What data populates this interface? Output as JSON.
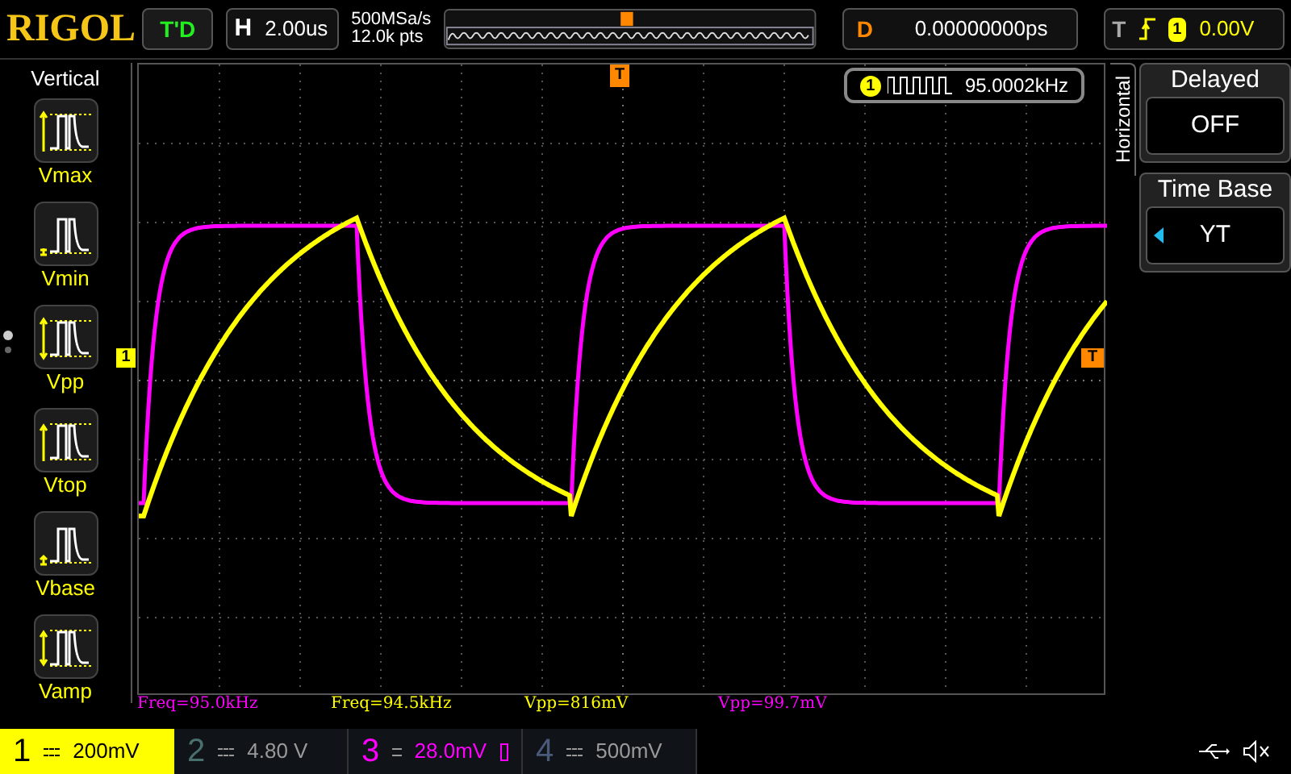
{
  "header": {
    "logo": "RIGOL",
    "run_status": "T'D",
    "horizontal_label": "H",
    "timebase": "2.00us",
    "sample_rate": "500MSa/s",
    "memory_depth": "12.0k pts",
    "delay_label": "D",
    "delay": "0.00000000ps",
    "trigger_label": "T",
    "trigger_channel": "1",
    "trigger_level": "0.00V"
  },
  "left_menu": {
    "title": "Vertical",
    "items": [
      {
        "label": "Vmax",
        "kind": "max"
      },
      {
        "label": "Vmin",
        "kind": "min"
      },
      {
        "label": "Vpp",
        "kind": "pp"
      },
      {
        "label": "Vtop",
        "kind": "top"
      },
      {
        "label": "Vbase",
        "kind": "base"
      },
      {
        "label": "Vamp",
        "kind": "amp"
      }
    ],
    "pages": [
      {
        "selected": true
      },
      {
        "selected": false
      }
    ]
  },
  "screen": {
    "channel_marker": "1",
    "trigger_marker_top": "T",
    "trigger_marker_right": "T",
    "counter": {
      "channel": "1",
      "frequency": "95.0002kHz"
    }
  },
  "right_menu": {
    "title": "Horizontal",
    "items": [
      {
        "label": "Delayed",
        "value": "OFF",
        "arrow": false
      },
      {
        "label": "Time Base",
        "value": "YT",
        "arrow": true
      }
    ]
  },
  "measurements": [
    {
      "text": "Freq=95.0kHz",
      "color": "#ff00ff"
    },
    {
      "text": "Freq=94.5kHz",
      "color": "#ffff00"
    },
    {
      "text": "Vpp=816mV",
      "color": "#ffff00"
    },
    {
      "text": "Vpp=99.7mV",
      "color": "#ff00ff"
    }
  ],
  "channels": [
    {
      "number": "1",
      "scale": "200mV",
      "color": "#ffff00",
      "selected": true,
      "badge": false
    },
    {
      "number": "2",
      "scale": "4.80 V",
      "color": "#4a6f6f",
      "selected": false,
      "badge": false
    },
    {
      "number": "3",
      "scale": "28.0mV",
      "color": "#ff00ff",
      "selected": false,
      "badge": true
    },
    {
      "number": "4",
      "scale": "500mV",
      "color": "#4a5a7a",
      "selected": false,
      "badge": false
    }
  ]
}
